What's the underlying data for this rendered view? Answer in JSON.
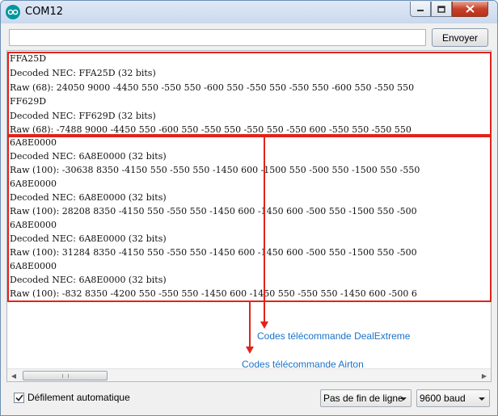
{
  "window": {
    "title": "COM12"
  },
  "send": {
    "input_value": "",
    "button_label": "Envoyer"
  },
  "monitor": {
    "lines": [
      "FFA25D",
      "Decoded NEC: FFA25D (32 bits)",
      "Raw (68): 24050 9000 -4450 550 -550 550 -600 550 -550 550 -550 550 -600 550 -550 550",
      "FF629D",
      "Decoded NEC: FF629D (32 bits)",
      "Raw (68): -7488 9000 -4450 550 -600 550 -550 550 -550 550 -550 600 -550 550 -550 550",
      "6A8E0000",
      "Decoded NEC: 6A8E0000 (32 bits)",
      "Raw (100): -30638 8350 -4150 550 -550 550 -1450 600 -1500 550 -500 550 -1500 550 -550",
      "6A8E0000",
      "Decoded NEC: 6A8E0000 (32 bits)",
      "Raw (100): 28208 8350 -4150 550 -550 550 -1450 600 -1450 600 -500 550 -1500 550 -500",
      "6A8E0000",
      "Decoded NEC: 6A8E0000 (32 bits)",
      "Raw (100): 31284 8350 -4150 550 -550 550 -1450 600 -1450 600 -500 550 -1500 550 -500",
      "6A8E0000",
      "Decoded NEC: 6A8E0000 (32 bits)",
      "Raw (100): -832 8350 -4200 550 -550 550 -1450 600 -1450 550 -550 550 -1450 600 -500 6"
    ]
  },
  "annotations": {
    "dealextreme": "Codes télécommande DealExtreme",
    "airton": "Codes télécommande Airton",
    "color": "#e2231a",
    "text_color": "#1a73c9"
  },
  "footer": {
    "autoscroll_label": "Défilement automatique",
    "autoscroll_checked": true,
    "line_ending": "Pas de fin de ligne",
    "baud_rate": "9600 baud"
  },
  "icons": {
    "app": "arduino-logo-icon",
    "minimize": "minimize-icon",
    "maximize": "maximize-icon",
    "close": "close-icon",
    "scroll_left": "scroll-left-icon",
    "scroll_right": "scroll-right-icon",
    "checkmark": "checkmark-icon",
    "dropdown": "chevron-down-icon"
  }
}
